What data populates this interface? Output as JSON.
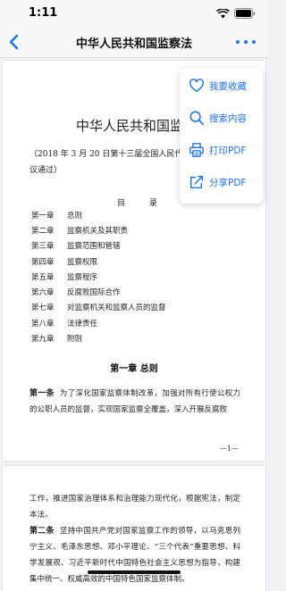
{
  "status_bar": {
    "time": "1:11"
  },
  "nav": {
    "title": "中华人民共和国监察法"
  },
  "popup_menu": {
    "items": [
      {
        "label": "我要收藏",
        "icon": "heart-icon"
      },
      {
        "label": "搜索内容",
        "icon": "search-icon"
      },
      {
        "label": "打印PDF",
        "icon": "printer-icon"
      },
      {
        "label": "分享PDF",
        "icon": "share-icon"
      }
    ]
  },
  "document": {
    "title": "中华人民共和国监察法",
    "note": "（2018 年 3 月 20 日第十三届全国人民代表大会第一次会议通过）",
    "toc_title": "目  录",
    "toc": [
      {
        "chapter": "第一章",
        "name": "总则"
      },
      {
        "chapter": "第二章",
        "name": "监察机关及其职责"
      },
      {
        "chapter": "第三章",
        "name": "监察范围和管辖"
      },
      {
        "chapter": "第四章",
        "name": "监察权限"
      },
      {
        "chapter": "第五章",
        "name": "监察程序"
      },
      {
        "chapter": "第六章",
        "name": "反腐败国际合作"
      },
      {
        "chapter": "第七章",
        "name": "对监察机关和监察人员的监督"
      },
      {
        "chapter": "第八章",
        "name": "法律责任"
      },
      {
        "chapter": "第九章",
        "name": "附则"
      }
    ],
    "chapter_heading": "第一章   总则",
    "article1_label": "第一条",
    "article1_text": "为了深化国家监察体制改革，加强对所有行使公权力的公职人员的监督，实现国家监察全覆盖，深入开展反腐败",
    "page_number": "—1—",
    "page2_para1": "工作，推进国家治理体系和治理能力现代化，根据宪法，制定本法。",
    "article2_label": "第二条",
    "article2_text": "坚持中国共产党对国家监察工作的领导，以马克思列宁主义、毛泽东思想、邓小平理论、“三个代表”重要思想、科学发展观、习近平新时代中国特色社会主义思想为指导，构建集中统一、权威高效的中国特色国家监察体制。"
  }
}
